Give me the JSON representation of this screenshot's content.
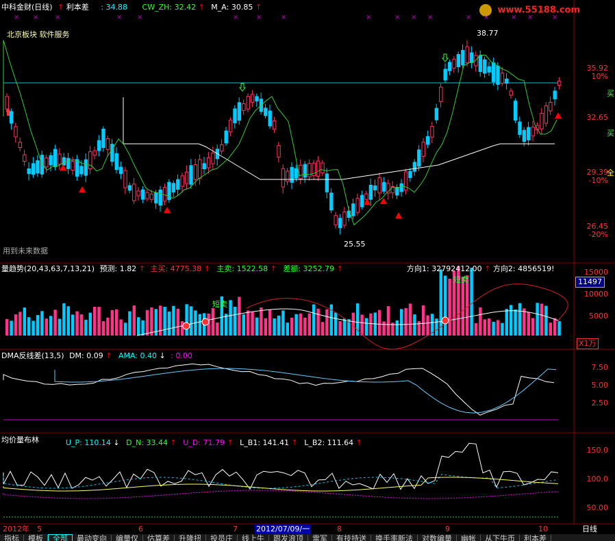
{
  "window": {
    "stock_name": "中科金财(日线)",
    "stat1_label": "利本差",
    "stat1_value": ": 34.88",
    "stat2": "CW_ZH: 32.42",
    "stat3": "M_A: 30.85",
    "watermark": "www.55188.com",
    "info_line": "北京板块 软件服务",
    "future_data": "用到未来数据"
  },
  "main_panel": {
    "price_ticks": [
      "35.92",
      "32.65",
      "29.39",
      "26.45"
    ],
    "pct_ticks": [
      "10%",
      "-10%",
      "-20%"
    ],
    "peak_label": "38.77",
    "low_label": "25.55",
    "side_letters": [
      "买",
      "买",
      "卖",
      "全"
    ]
  },
  "volume_panel": {
    "title": "量趋势(20,43,63,7,13,21)",
    "forecast": "预测: 1.82",
    "main_buy": "主买: 4775.38",
    "main_sell": "主卖: 1522.58",
    "diff": "差额: 3252.79",
    "dir1": "方向1: 32792412.00",
    "dir2": "方向2: 4856519!",
    "ticks": [
      "15000",
      "10000",
      "5000"
    ],
    "current_value": "11497",
    "unit": "X1万",
    "annot1": "短卖",
    "annot2": "短卖"
  },
  "dma_panel": {
    "title": "DMA反线差(13,5)",
    "dm": "DM: 0.09",
    "ama": "AMA: 0.40",
    "third": ": 0.00",
    "ticks": [
      "7.50",
      "5.00",
      "2.50"
    ]
  },
  "boll_panel": {
    "title": "均价量布林",
    "up": "U_P: 110.14",
    "dn": "D_N: 33.44",
    "ud": "U_D: 71.79",
    "lb1": "L_B1: 141.41",
    "lb2": "L_B2: 111.64",
    "ticks": [
      "150.0",
      "100.0",
      "50.00"
    ]
  },
  "time_axis": {
    "year": "2012年",
    "months": [
      "5",
      "6",
      "7",
      "8",
      "9",
      "10"
    ],
    "cursor_date": "2012/07/09/一",
    "period": "日线"
  },
  "bottom_tabs": [
    "指标",
    "模板",
    "全部",
    "最动变向",
    "编量仅",
    "估算差",
    "升隆扭",
    "投员庄",
    "线上牛",
    "跟发浪顶",
    "雷军",
    "有技持送",
    "换手率新法",
    "对数编量",
    "幽帐",
    "从下牛币",
    "利本差"
  ],
  "colors": {
    "up": "#ff3366",
    "down": "#00ccff",
    "ma_white": "#ffffff",
    "ma_green": "#33cc33",
    "cyan_line": "#00ffff",
    "magenta": "#ff00ff",
    "red_axis": "#ff0000",
    "yellow": "#ffff00"
  }
}
